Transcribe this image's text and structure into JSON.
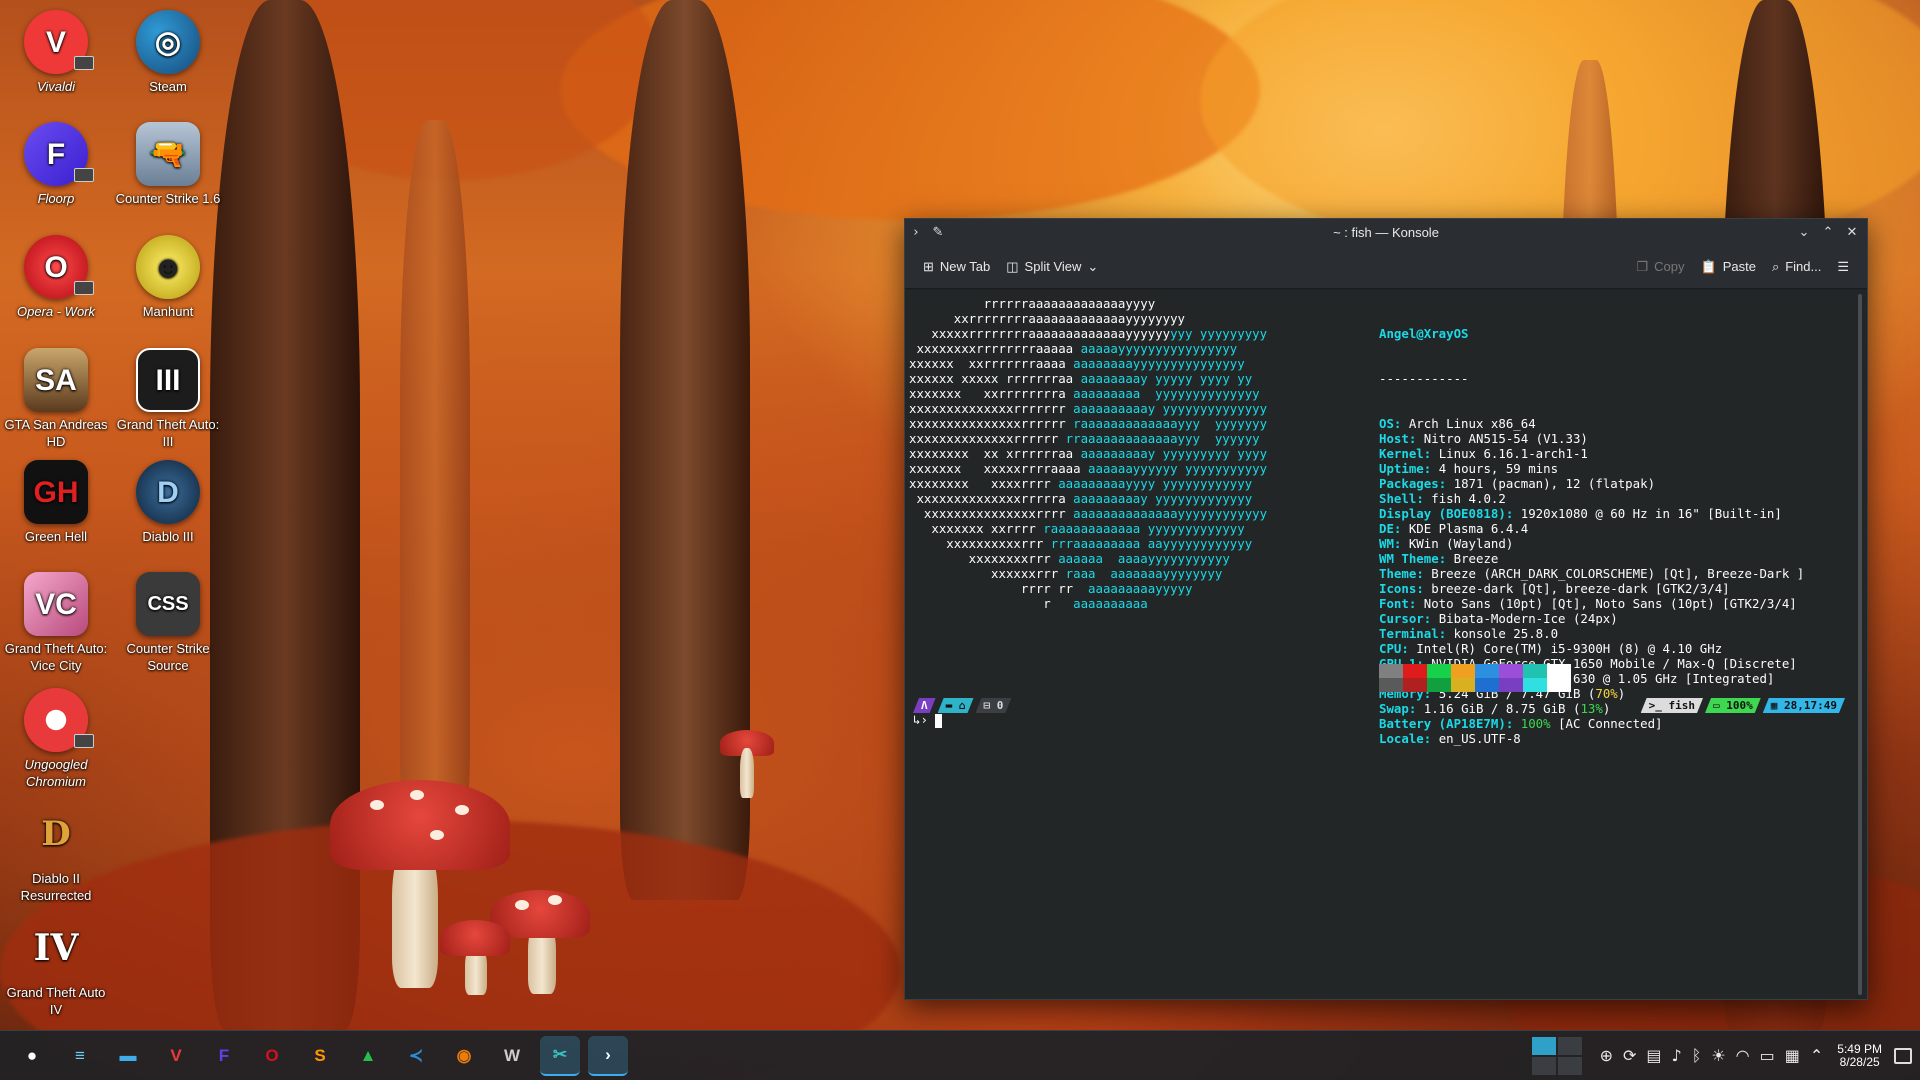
{
  "desktop_icons": [
    {
      "label": "Vivaldi",
      "icon": "vivaldi-icon",
      "color": "#ef3939"
    },
    {
      "label": "Steam",
      "icon": "steam-icon",
      "color": "#1b2838"
    },
    {
      "label": "Floorp",
      "icon": "floorp-icon",
      "color": "#4b3ce6"
    },
    {
      "label": "Counter Strike 1.6",
      "icon": "counter-strike-icon",
      "color": "#8aa0b8"
    },
    {
      "label": "Opera - Work",
      "icon": "opera-icon",
      "color": "#d5121c"
    },
    {
      "label": "Manhunt",
      "icon": "manhunt-icon",
      "color": "#d7c21c"
    },
    {
      "label": "GTA San Andreas HD",
      "icon": "gta-sa-icon",
      "color": "#6b4a2a"
    },
    {
      "label": "Grand Theft Auto: III",
      "icon": "gta-iii-icon",
      "color": "#222222"
    },
    {
      "label": "Green Hell",
      "icon": "green-hell-icon",
      "color": "#111111"
    },
    {
      "label": "Diablo III",
      "icon": "diablo-iii-icon",
      "color": "#1e3a5c"
    },
    {
      "label": "Grand Theft Auto: Vice City",
      "icon": "gta-vc-icon",
      "color": "#e88fb6"
    },
    {
      "label": "Counter Strike Source",
      "icon": "css-icon",
      "color": "#444444"
    },
    {
      "label": "Ungoogled Chromium",
      "icon": "chromium-icon",
      "color": "#e83a3a"
    },
    {
      "label": "Diablo II Resurrected",
      "icon": "diablo-ii-icon",
      "color": "#5a2a0a"
    },
    {
      "label": "Grand Theft Auto IV",
      "icon": "gta-iv-icon",
      "color": "#333333"
    }
  ],
  "window": {
    "title": "~ : fish — Konsole",
    "toolbar": {
      "new_tab": "New Tab",
      "split_view": "Split View",
      "copy": "Copy",
      "paste": "Paste",
      "find": "Find..."
    }
  },
  "terminal": {
    "user_host": "Angel@XrayOS",
    "separator": "------------",
    "info": [
      {
        "key": "OS",
        "value": "Arch Linux x86_64"
      },
      {
        "key": "Host",
        "value": "Nitro AN515-54 (V1.33)"
      },
      {
        "key": "Kernel",
        "value": "Linux 6.16.1-arch1-1"
      },
      {
        "key": "Uptime",
        "value": "4 hours, 59 mins"
      },
      {
        "key": "Packages",
        "value": "1871 (pacman), 12 (flatpak)"
      },
      {
        "key": "Shell",
        "value": "fish 4.0.2"
      },
      {
        "key": "Display (BOE0818)",
        "value": "1920x1080 @ 60 Hz in 16\" [Built-in]"
      },
      {
        "key": "DE",
        "value": "KDE Plasma 6.4.4"
      },
      {
        "key": "WM",
        "value": "KWin (Wayland)"
      },
      {
        "key": "WM Theme",
        "value": "Breeze"
      },
      {
        "key": "Theme",
        "value": "Breeze (ARCH_DARK_COLORSCHEME) [Qt], Breeze-Dark ]"
      },
      {
        "key": "Icons",
        "value": "breeze-dark [Qt], breeze-dark [GTK2/3/4]"
      },
      {
        "key": "Font",
        "value": "Noto Sans (10pt) [Qt], Noto Sans (10pt) [GTK2/3/4]"
      },
      {
        "key": "Cursor",
        "value": "Bibata-Modern-Ice (24px)"
      },
      {
        "key": "Terminal",
        "value": "konsole 25.8.0"
      },
      {
        "key": "CPU",
        "value": "Intel(R) Core(TM) i5-9300H (8) @ 4.10 GHz"
      },
      {
        "key": "GPU 1",
        "value": "NVIDIA GeForce GTX 1650 Mobile / Max-Q [Discrete]"
      },
      {
        "key": "GPU 2",
        "value": "Intel UHD Graphics 630 @ 1.05 GHz [Integrated]"
      },
      {
        "key": "Memory",
        "value": "5.24 GiB / 7.47 GiB",
        "pct": "70%",
        "pct_color": "#f4d63c"
      },
      {
        "key": "Swap",
        "value": "1.16 GiB / 8.75 GiB",
        "pct": "13%",
        "pct_color": "#3dd84f"
      },
      {
        "key": "Battery (AP18E7M)",
        "value": "[AC Connected]",
        "pre": "100%",
        "pre_color": "#3dd84f"
      },
      {
        "key": "Locale",
        "value": "en_US.UTF-8"
      }
    ],
    "logo_lines": [
      [
        "          rrrrrraaaaaaaaaaaaayyyy",
        ""
      ],
      [
        "      xxrrrrrrrraaaaaaaaaaaaayyyyyyyy",
        ""
      ],
      [
        "   xxxxxrrrrrrrraaaaaaaaaaaaayyyyyy",
        "yyy yyyyyyyyy"
      ],
      [
        " xxxxxxxxrrrrrrrraaaaa ",
        "aaaaayyyyyyyyyyyyyyyy"
      ],
      [
        "xxxxxx  xxrrrrrrraaaa ",
        "aaaaaaaayyyyyyyyyyyyyyy"
      ],
      [
        "xxxxxx xxxxx rrrrrrraa ",
        "aaaaaaaay yyyyy yyyy yy"
      ],
      [
        "xxxxxxx   xxrrrrrrrra ",
        "aaaaaaaaa  yyyyyyyyyyyyyy"
      ],
      [
        "xxxxxxxxxxxxxxrrrrrrr ",
        "aaaaaaaaaay yyyyyyyyyyyyyy"
      ],
      [
        "xxxxxxxxxxxxxxxrrrrrr ",
        "raaaaaaaaaaaaayyy  yyyyyyy"
      ],
      [
        "xxxxxxxxxxxxxxrrrrrr ",
        "rraaaaaaaaaaaaayyy  yyyyyy"
      ],
      [
        "xxxxxxxx  xx xrrrrrraa ",
        "aaaaaaaaay yyyyyyyyy yyyy"
      ],
      [
        "xxxxxxx   xxxxxrrrraaaa ",
        "aaaaaayyyyyy yyyyyyyyyyy"
      ],
      [
        "xxxxxxxx   xxxxrrrr ",
        "aaaaaaaaayyyy yyyyyyyyyyyy"
      ],
      [
        " xxxxxxxxxxxxxxrrrrra ",
        "aaaaaaaaay yyyyyyyyyyyyy"
      ],
      [
        "  xxxxxxxxxxxxxxxrrrr ",
        "aaaaaaaaaaaaaayyyyyyyyyyyy"
      ],
      [
        "   xxxxxxx xxrrrr ",
        "raaaaaaaaaaaa yyyyyyyyyyyyy"
      ],
      [
        "     xxxxxxxxxxrrr ",
        "rrraaaaaaaaa aayyyyyyyyyyyy"
      ],
      [
        "        xxxxxxxxrrr ",
        "aaaaaa  aaaayyyyyyyyyyy"
      ],
      [
        "           xxxxxxrrr ",
        "raaa  aaaaaaayyyyyyyy"
      ],
      [
        "               rrrr rr  ",
        "aaaaaaaaayyyyy"
      ],
      [
        "                  r   ",
        "aaaaaaaaaa"
      ]
    ],
    "palette": [
      "#808080",
      "#e01b1b",
      "#18d14b",
      "#f0a020",
      "#2d8fe0",
      "#9b4fd8",
      "#22c2b0",
      "#ffffff",
      "#5a5a5a",
      "#b02020",
      "#10a040",
      "#d8b020",
      "#1e6fd0",
      "#7a3ec0",
      "#30e0e0",
      "#ffffff"
    ],
    "prompt": {
      "right_shell": "fish",
      "right_battery": "100%",
      "right_time": "28,17:49",
      "left_jobs": "0"
    }
  },
  "taskbar": {
    "apps": [
      {
        "name": "app-launcher-icon",
        "glyph": "●",
        "color": "#ffffff"
      },
      {
        "name": "system-settings-icon",
        "glyph": "≡",
        "color": "#6ec7f5"
      },
      {
        "name": "file-manager-icon",
        "glyph": "▬",
        "color": "#3daee9"
      },
      {
        "name": "vivaldi-taskbar-icon",
        "glyph": "V",
        "color": "#ef3939"
      },
      {
        "name": "floorp-taskbar-icon",
        "glyph": "F",
        "color": "#5b43e8"
      },
      {
        "name": "opera-taskbar-icon",
        "glyph": "O",
        "color": "#d5121c"
      },
      {
        "name": "sublime-text-icon",
        "glyph": "S",
        "color": "#ff9800"
      },
      {
        "name": "vectorize-icon",
        "glyph": "▲",
        "color": "#24c04a"
      },
      {
        "name": "vscode-icon",
        "glyph": "≺",
        "color": "#2a8fd8"
      },
      {
        "name": "blender-icon",
        "glyph": "◉",
        "color": "#e87d0d"
      },
      {
        "name": "steam-wine-icon",
        "glyph": "W",
        "color": "#cccccc"
      },
      {
        "name": "kdenlive-icon",
        "glyph": "✂",
        "color": "#3bc1c1"
      },
      {
        "name": "konsole-taskbar-icon",
        "glyph": "›",
        "color": "#ffffff"
      }
    ],
    "clock_time": "5:49 PM",
    "clock_date": "8/28/25"
  }
}
